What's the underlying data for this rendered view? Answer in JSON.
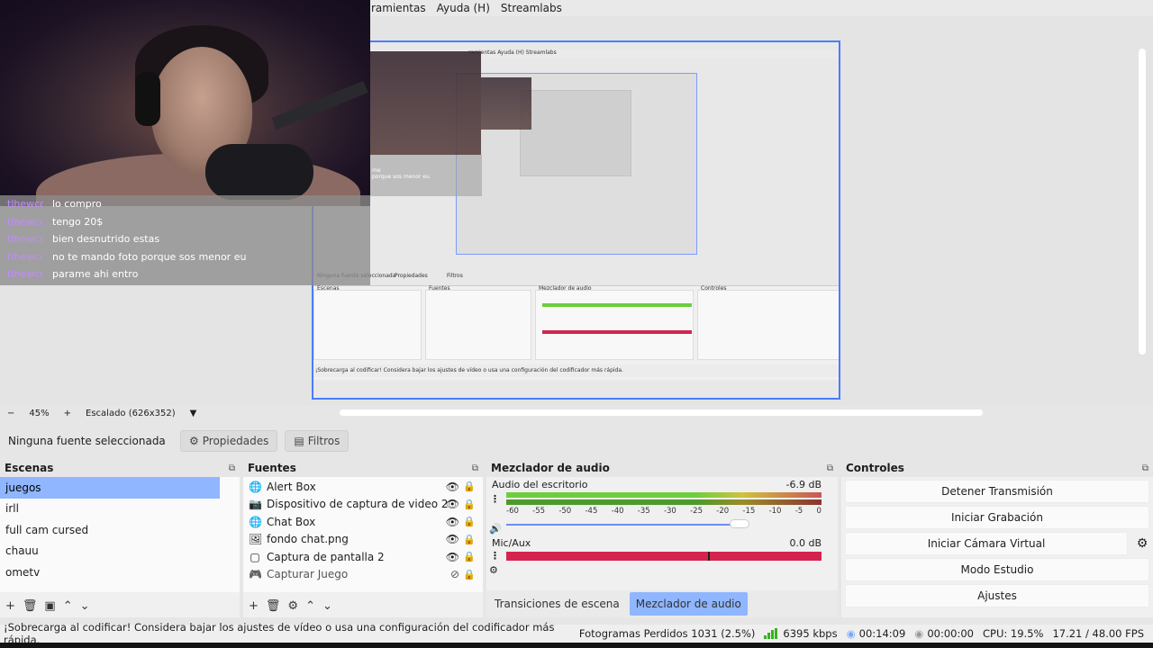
{
  "menu": {
    "items": [
      "ramientas",
      "Ayuda (H)",
      "Streamlabs"
    ]
  },
  "chat": {
    "messages": [
      {
        "user": "tlhewcc",
        "text": "lo compro"
      },
      {
        "user": "tlhewcc",
        "text": "tengo 20$"
      },
      {
        "user": "tlhewcc",
        "text": "bien desnutrido estas"
      },
      {
        "user": "tlhewcc",
        "text": "no te mando foto porque sos menor eu"
      },
      {
        "user": "tlhewcc",
        "text": "parame ahi entro"
      }
    ],
    "ghost": [
      "me",
      "porque sos menor eu"
    ]
  },
  "zoom": {
    "minus": "−",
    "percent": "45%",
    "plus": "+",
    "scale_label": "Escalado (626x352)",
    "dropdown_icon": "▼"
  },
  "props": {
    "no_source": "Ninguna fuente seleccionada",
    "properties_label": "Propiedades",
    "filters_label": "Filtros",
    "properties_icon": "⚙",
    "filters_icon": "▤"
  },
  "scenes": {
    "title": "Escenas",
    "items": [
      "juegos",
      "irll",
      "full cam cursed",
      "chauu",
      "ometv"
    ],
    "selected": 0,
    "tools": [
      "+",
      "🗑",
      "▣",
      "⌃",
      "⌄"
    ]
  },
  "sources": {
    "title": "Fuentes",
    "items": [
      {
        "icon": "🌐",
        "label": "Alert Box",
        "visible": "👁",
        "lock": "🔒"
      },
      {
        "icon": "📷",
        "label": "Dispositivo de captura de video 2",
        "visible": "👁",
        "lock": "🔒"
      },
      {
        "icon": "🌐",
        "label": "Chat Box",
        "visible": "👁",
        "lock": "🔒"
      },
      {
        "icon": "🖼",
        "label": "fondo chat.png",
        "visible": "👁",
        "lock": "🔒"
      },
      {
        "icon": "▢",
        "label": "Captura de pantalla 2",
        "visible": "👁",
        "lock": "🔒"
      },
      {
        "icon": "🎮",
        "label": "Capturar Juego",
        "visible": "⊘",
        "lock": "🔒"
      }
    ],
    "tools": [
      "+",
      "🗑",
      "⚙",
      "⌃",
      "⌄"
    ]
  },
  "mixer": {
    "title": "Mezclador de audio",
    "desktop": {
      "name": "Audio del escritorio",
      "db": "-6.9 dB"
    },
    "ticks": [
      "-60",
      "-55",
      "-50",
      "-45",
      "-40",
      "-35",
      "-30",
      "-25",
      "-20",
      "-15",
      "-10",
      "-5",
      "0"
    ],
    "mic": {
      "name": "Mic/Aux",
      "db": "0.0 dB"
    },
    "tabs": [
      "Transiciones de escena",
      "Mezclador de audio"
    ]
  },
  "controls": {
    "title": "Controles",
    "buttons": [
      "Detener Transmisión",
      "Iniciar Grabación",
      "Iniciar Cámara Virtual",
      "Modo Estudio",
      "Ajustes"
    ]
  },
  "status": {
    "warning": "¡Sobrecarga al codificar! Considera bajar los ajustes de vídeo o usa una configuración del codificador más rápida.",
    "dropped": "Fotogramas Perdidos 1031 (2.5%)",
    "bitrate": "6395 kbps",
    "stream_time": "00:14:09",
    "rec_time": "00:00:00",
    "cpu": "CPU: 19.5%",
    "fps": "17.21 / 48.00 FPS"
  },
  "nested": {
    "menu": "ramientas  Ayuda (H)  Streamlabs",
    "no_source": "Ninguna fuente seleccionada",
    "props": "Propiedades",
    "filters": "Filtros",
    "scenes_title": "Escenas",
    "sources_title": "Fuentes",
    "mixer_title": "Mezclador de audio",
    "controls_title": "Controles",
    "status": "¡Sobrecarga al codificar! Considera bajar los ajustes de vídeo o usa una configuración del codificador más rápida."
  },
  "colors": {
    "accent": "#8fb6ff",
    "selection_border": "#4a7cff",
    "meter_green": "#6dce3d",
    "mic_red": "#d4244e",
    "chat_user": "#c08cff"
  }
}
